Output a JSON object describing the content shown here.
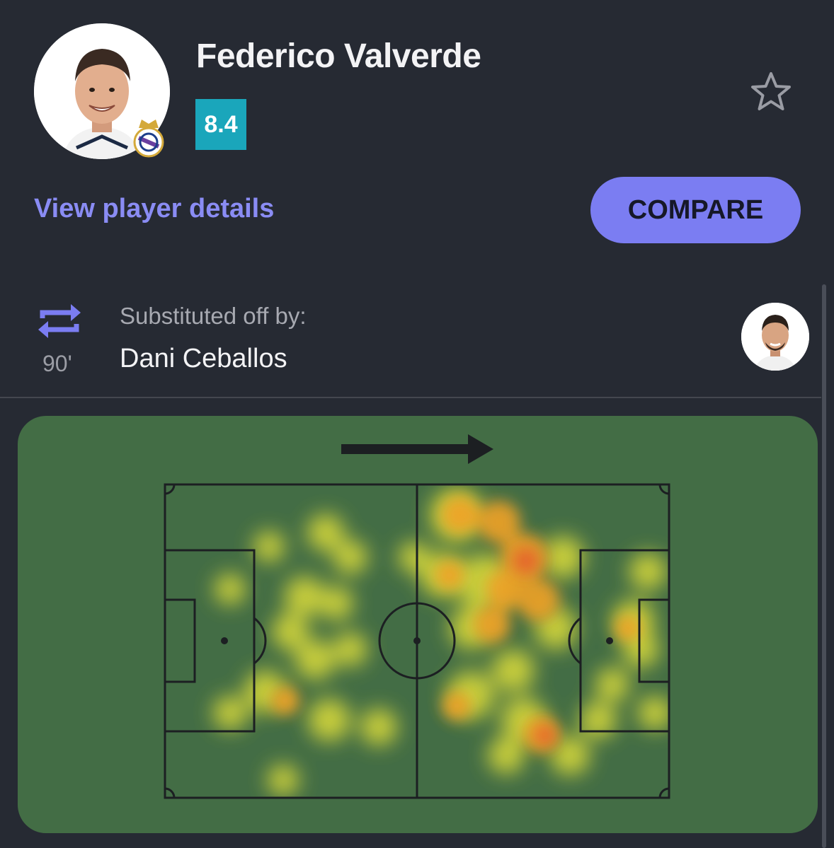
{
  "player": {
    "name": "Federico Valverde",
    "rating": "8.4",
    "rating_color": "#1aa6bb"
  },
  "actions": {
    "details_link": "View player details",
    "compare_button": "COMPARE",
    "favorite_icon": "star-outline-icon"
  },
  "substitution": {
    "icon": "swap-arrows-icon",
    "minute": "90'",
    "label": "Substituted off by:",
    "player": "Dani Ceballos"
  },
  "heatmap": {
    "attack_direction": "right",
    "pitch_color": "#436d45",
    "line_color": "#1c1f22"
  },
  "colors": {
    "background": "#262a33",
    "accent": "#7b7df2",
    "link": "#8a8cf4"
  }
}
